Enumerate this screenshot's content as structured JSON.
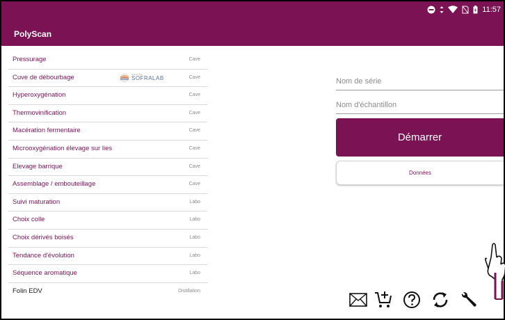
{
  "status_bar": {
    "time": "11:57"
  },
  "app": {
    "title": "PolyScan"
  },
  "logo": {
    "small_text": "GROUPE",
    "main_text": "SOFRALAB"
  },
  "list": [
    {
      "name": "Pressurage",
      "category": "Cave"
    },
    {
      "name": "Cuve de débourbage",
      "category": "Cave"
    },
    {
      "name": "Hyperoxygénation",
      "category": "Cave"
    },
    {
      "name": "Thermovinification",
      "category": "Cave"
    },
    {
      "name": "Macération fermentaire",
      "category": "Cave"
    },
    {
      "name": "Microoxygénation élevage sur lies",
      "category": "Cave"
    },
    {
      "name": "Elevage barrique",
      "category": "Cave"
    },
    {
      "name": "Assemblage / embouteillage",
      "category": "Cave"
    },
    {
      "name": "Suivi maturation",
      "category": "Labo"
    },
    {
      "name": "Choix colle",
      "category": "Labo"
    },
    {
      "name": "Choix dérivés boisés",
      "category": "Labo"
    },
    {
      "name": "Tendance d'évolution",
      "category": "Labo"
    },
    {
      "name": "Séquence aromatique",
      "category": "Labo"
    },
    {
      "name": "Folin EDV",
      "category": "Distillation"
    }
  ],
  "form": {
    "series_placeholder": "Nom de série",
    "sample_placeholder": "Nom d'échantillon",
    "start_label": "Démarrer",
    "data_label": "Données"
  },
  "toolbar": {
    "icons": [
      "mail-icon",
      "cart-add-icon",
      "help-icon",
      "refresh-icon",
      "wrench-icon"
    ]
  },
  "colors": {
    "primary": "#7a1254",
    "list_text": "#7a1254",
    "category_text": "#8a8a8a"
  }
}
